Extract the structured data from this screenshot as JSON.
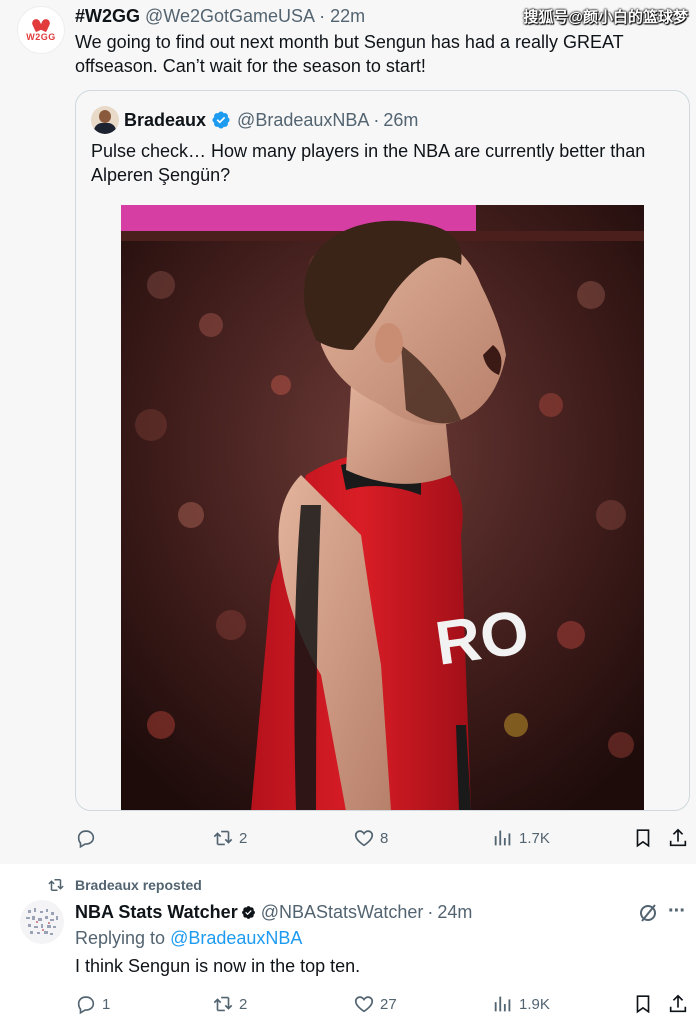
{
  "watermark": "搜狐号@颜小白的篮球梦",
  "tweet1": {
    "avatar_text": "W2GG",
    "name": "#W2GG",
    "handle": "@We2GotGameUSA",
    "separator": "·",
    "time": "22m",
    "text": "We going to find out next month but Sengun has had a really GREAT offseason. Can’t wait for the season to start!",
    "quote": {
      "name": "Bradeaux",
      "handle": "@BradeauxNBA",
      "separator": "·",
      "time": "26m",
      "text": "Pulse check… How many players in the NBA are currently better than Alperen Şengün?",
      "photo_jersey_text": "RO"
    },
    "stats": {
      "replies": "",
      "reposts": "2",
      "likes": "8",
      "views": "1.7K"
    }
  },
  "tweet2": {
    "repost_label": "Bradeaux reposted",
    "name": "NBA Stats Watcher",
    "handle": "@NBAStatsWatcher",
    "separator": "·",
    "time": "24m",
    "replying_prefix": "Replying to",
    "replying_to": "@BradeauxNBA",
    "text": "I think Sengun is now in the top ten.",
    "more": "···",
    "stats": {
      "replies": "1",
      "reposts": "2",
      "likes": "27",
      "views": "1.9K"
    }
  },
  "colors": {
    "accent": "#1d9bf0",
    "text_secondary": "#536471",
    "rockets_red": "#ce1126"
  },
  "icons": [
    "reply-icon",
    "repost-icon",
    "like-icon",
    "views-icon",
    "bookmark-icon",
    "share-icon",
    "verified-icon",
    "grok-icon",
    "more-icon"
  ]
}
